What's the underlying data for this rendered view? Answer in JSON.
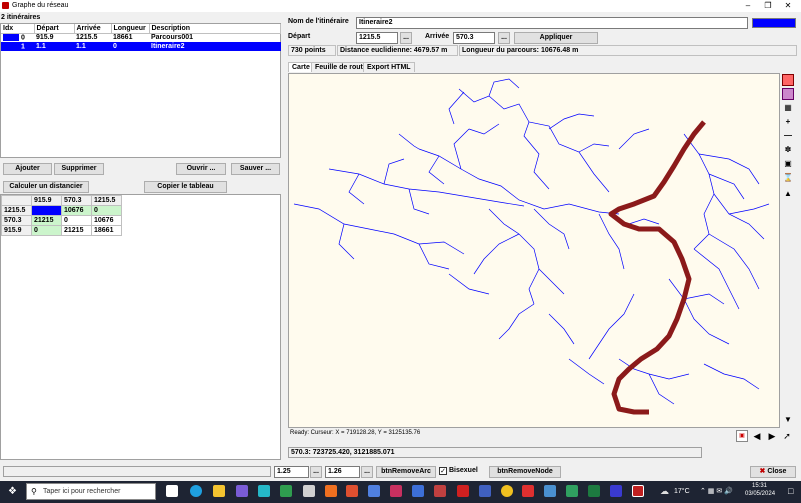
{
  "window": {
    "title": "Graphe du réseau",
    "icons": {
      "app": "app-icon",
      "minimize": "minimize-icon",
      "maximize": "maximize-icon",
      "close": "close-icon"
    }
  },
  "itineraries": {
    "header": "2 itinéraires",
    "columns": [
      "Idx",
      "Départ",
      "Arrivée",
      "Longueur",
      "Description"
    ],
    "rows": [
      [
        "0",
        "915.9",
        "1215.5",
        "18661",
        "Parcours001"
      ],
      [
        "1",
        "1.1",
        "1.1",
        "0",
        "Itineraire2"
      ]
    ],
    "selected_row": 1,
    "color_swatch": "#0000ff"
  },
  "left_buttons": {
    "add": "Ajouter",
    "remove": "Supprimer",
    "open": "Ouvrir ...",
    "save": "Sauver ...",
    "compute": "Calculer un distancier",
    "copy": "Copier le tableau"
  },
  "distance_matrix": {
    "columns": [
      "",
      "915.9",
      "570.3",
      "1215.5"
    ],
    "rows": [
      [
        "1215.5",
        "",
        "10676",
        "0"
      ],
      [
        "570.3",
        "21215",
        "0",
        "10676"
      ],
      [
        "915.9",
        "0",
        "21215",
        "18661"
      ]
    ]
  },
  "itinerary_form": {
    "name_label": "Nom de l'itinéraire",
    "name_value": "Itineraire2",
    "color": "#0000ff",
    "start_label": "Départ",
    "start_value": "1215.5",
    "start_browse": "...",
    "end_label": "Arrivée",
    "end_value": "570.3",
    "end_browse": "...",
    "apply": "Appliquer",
    "points": "730 points",
    "euclidean": "Distance euclidienne: 4679.57 m",
    "route_length": "Longueur du parcours: 10676.48 m"
  },
  "tabs": [
    "Carte",
    "Feuille de route",
    "Export HTML"
  ],
  "active_tab": 0,
  "map": {
    "background": "#fffbee",
    "network_color": "#0000ff",
    "route_color": "#8b1a1a",
    "cursor_status": "Ready: Curseur: X = 719128.28, Y = 3125135.76"
  },
  "status_line": "570.3: 723725.420, 3121885.071",
  "tools": [
    "layer-red-icon",
    "layer-purple-icon",
    "layer-edit-icon",
    "zoom-in-icon",
    "zoom-out-icon",
    "ruler-icon",
    "select-icon",
    "hourglass-icon",
    "arrow-up-icon",
    "arrow-down-icon"
  ],
  "nav_icons": [
    "overview-icon",
    "arrow-left-icon",
    "arrow-right-icon",
    "pointer-icon"
  ],
  "bottom_bar": {
    "value1": "1.25",
    "btn1": "...",
    "value2": "1.26",
    "btn2": "...",
    "remove_arc": "btnRemoveArc",
    "bisexual_label": "Bisexuel",
    "bisexual_checked": true,
    "remove_node": "btnRemoveNode",
    "close": "Close"
  },
  "taskbar": {
    "search_placeholder": "Taper ici pour rechercher",
    "temperature": "17°C",
    "time": "15:31",
    "date": "03/05/2024"
  }
}
